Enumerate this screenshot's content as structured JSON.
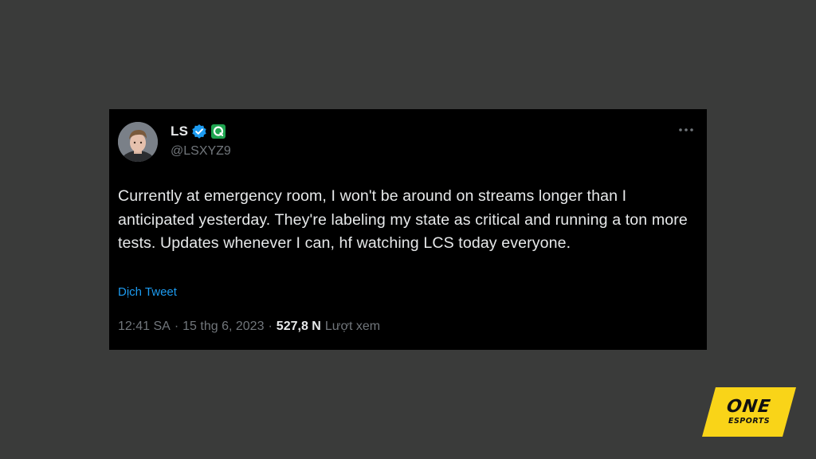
{
  "tweet": {
    "display_name": "LS",
    "handle": "@LSXYZ9",
    "text": "Currently at emergency room, I won't be around on streams longer than I anticipated yesterday. They're labeling my state as critical and running a ton more tests. Updates whenever I can, hf watching LCS today everyone.",
    "translate_label": "Dịch Tweet",
    "time": "12:41 SA",
    "date": "15 thg 6, 2023",
    "separator": "·",
    "views_count": "527,8 N",
    "views_label": "Lượt xem",
    "badges": [
      "verified-check-icon",
      "affiliate-badge-icon"
    ],
    "colors": {
      "card_bg": "#000000",
      "text": "#e7e9ea",
      "muted": "#71767b",
      "link": "#1d9bf0",
      "verified": "#1d9bf0",
      "affiliate_badge": "#1fa550"
    }
  },
  "watermark": {
    "line1": "ONE",
    "line2": "ESPORTS",
    "bg_color": "#f9d418"
  },
  "page": {
    "background": "#3a3b3a"
  }
}
